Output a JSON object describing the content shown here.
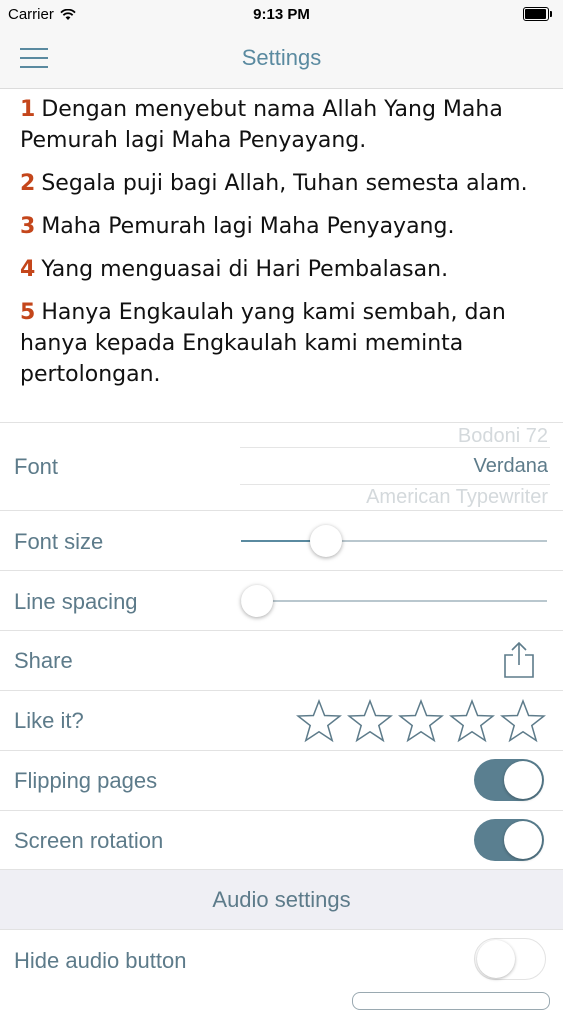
{
  "status_bar": {
    "carrier": "Carrier",
    "time": "9:13 PM"
  },
  "nav": {
    "title": "Settings"
  },
  "verses": [
    {
      "num": "1",
      "text": "Dengan menyebut nama Allah Yang Maha Pemurah lagi Maha Penyayang."
    },
    {
      "num": "2",
      "text": "Segala puji bagi Allah, Tuhan semesta alam."
    },
    {
      "num": "3",
      "text": "Maha Pemurah lagi Maha Penyayang."
    },
    {
      "num": "4",
      "text": "Yang menguasai di Hari Pembalasan."
    },
    {
      "num": "5",
      "text": "Hanya Engkaulah yang kami sembah, dan hanya kepada Engkaulah kami meminta pertolongan."
    }
  ],
  "settings": {
    "font": {
      "label": "Font",
      "options": [
        "Bodoni 72",
        "Verdana",
        "American Typewriter"
      ],
      "selected": "Verdana"
    },
    "font_size": {
      "label": "Font size",
      "value_fraction": 0.25
    },
    "line_spacing": {
      "label": "Line spacing",
      "value_fraction": 0.0
    },
    "share": {
      "label": "Share",
      "icon": "share-icon"
    },
    "like": {
      "label": "Like it?",
      "stars_total": 5,
      "stars_filled": 0
    },
    "flipping_pages": {
      "label": "Flipping pages",
      "on": true
    },
    "screen_rotation": {
      "label": "Screen rotation",
      "on": true
    },
    "audio_header": "Audio settings",
    "hide_audio": {
      "label": "Hide audio button",
      "on": false
    }
  },
  "colors": {
    "accent": "#5a8aa0",
    "verse_number": "#c4461b",
    "toggle_on": "#5a7f90"
  }
}
